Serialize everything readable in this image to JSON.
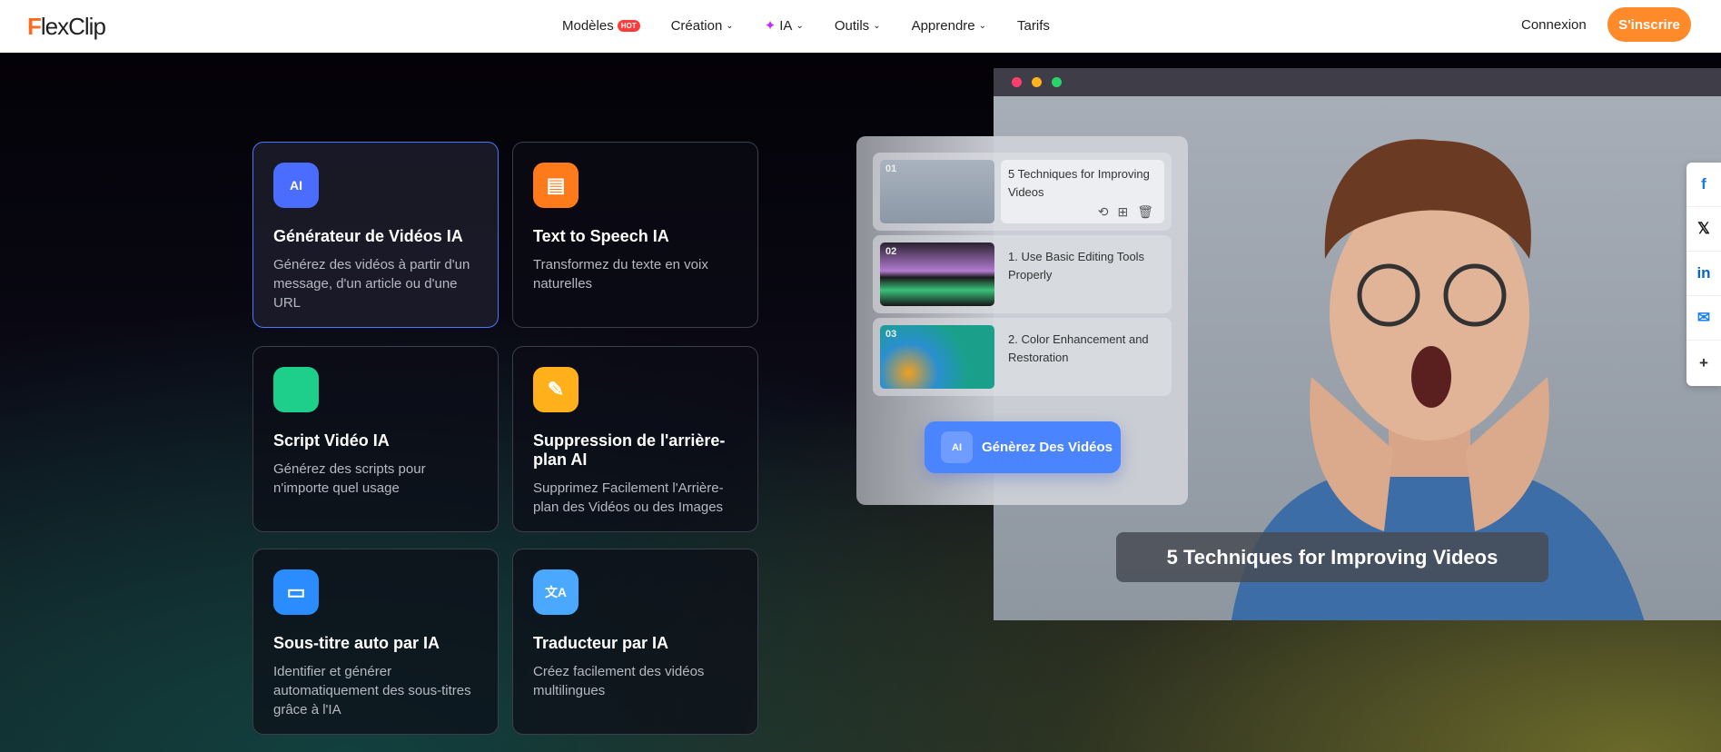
{
  "header": {
    "logo": "FlexClip",
    "nav": [
      {
        "label": "Modèles",
        "badge": "HOT"
      },
      {
        "label": "Création"
      },
      {
        "label": "IA"
      },
      {
        "label": "Outils"
      },
      {
        "label": "Apprendre"
      },
      {
        "label": "Tarifs"
      }
    ],
    "login": "Connexion",
    "signup": "S'inscrire"
  },
  "cards": [
    {
      "title": "Générateur de Vidéos IA",
      "desc": "Générez des vidéos à partir d'un message, d'un article ou d'une URL",
      "icon": "ai-video-icon",
      "color": "#4a6cff",
      "active": true
    },
    {
      "title": "Text to Speech IA",
      "desc": "Transformez du texte en voix naturelles",
      "icon": "speech-bubble-icon",
      "color": "#ff7a1a"
    },
    {
      "title": "Script Vidéo IA",
      "desc": "Générez des scripts pour n'importe quel usage",
      "icon": "script-icon",
      "color": "#1dcf8a"
    },
    {
      "title": "Suppression de l'arrière-plan AI",
      "desc": "Supprimez Facilement l'Arrière-plan des Vidéos ou des Images",
      "icon": "eraser-icon",
      "color": "#ffb01a"
    },
    {
      "title": "Sous-titre auto par IA",
      "desc": "Identifier et générer automatiquement des sous-titres grâce à l'IA",
      "icon": "subtitle-icon",
      "color": "#2a8cff"
    },
    {
      "title": "Traducteur par IA",
      "desc": "Créez facilement des vidéos multilingues",
      "icon": "translate-icon",
      "color": "#4aa8ff"
    }
  ],
  "preview": {
    "items": [
      {
        "num": "01",
        "title": "5 Techniques for Improving Videos"
      },
      {
        "num": "02",
        "title": "1. Use Basic Editing Tools Properly"
      },
      {
        "num": "03",
        "title": "2. Color Enhancement and Restoration"
      }
    ],
    "generate": "Génèrez Des Vidéos",
    "ai_badge": "AI",
    "caption": "5 Techniques for Improving Videos"
  },
  "social": [
    "f",
    "𝕏",
    "in",
    "✉",
    "+"
  ]
}
